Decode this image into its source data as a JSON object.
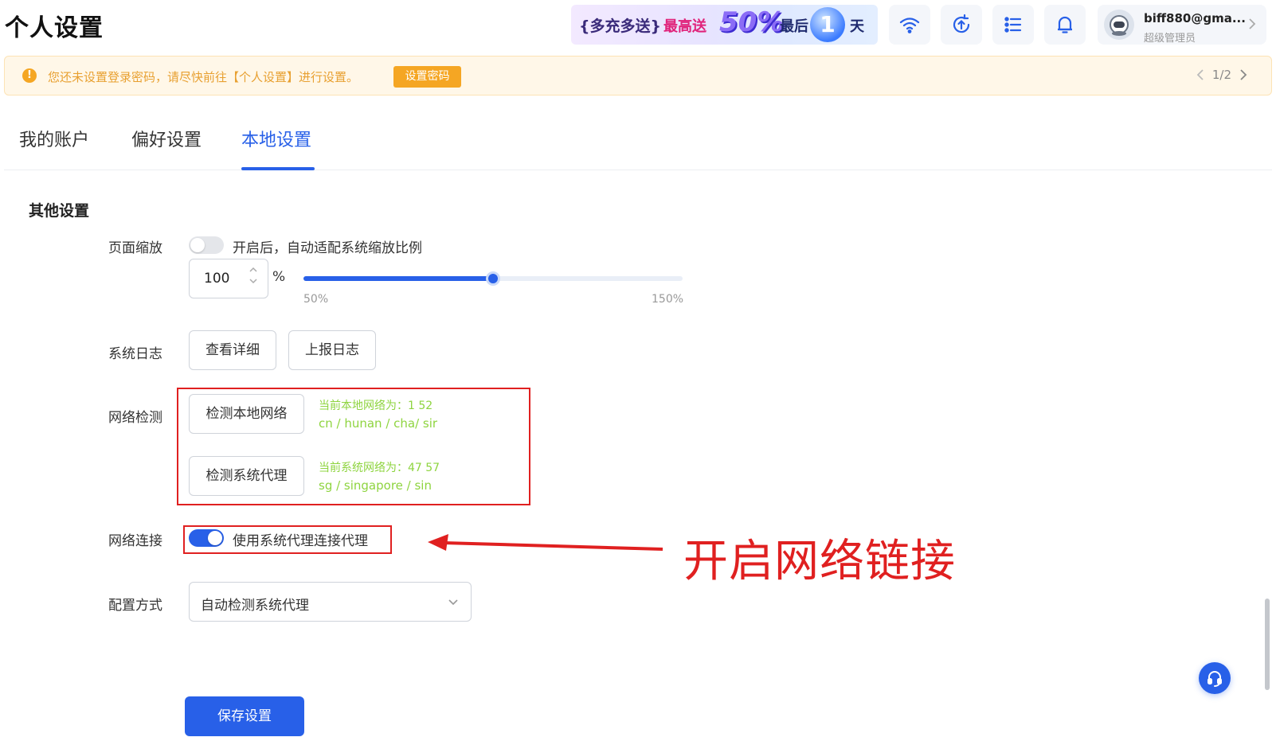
{
  "header": {
    "title": "个人设置",
    "promo": {
      "part1": "{多充多送}",
      "part2": "最高送",
      "part3": "50%",
      "part4": "最后",
      "part5": "1",
      "part6": "天"
    },
    "icons": [
      "wifi-icon",
      "sync-upload-icon",
      "list-icon",
      "bell-icon"
    ],
    "user": {
      "name": "biff880@gma...",
      "role": "超级管理员"
    }
  },
  "notice": {
    "text": "您还未设置登录密码，请尽快前往【个人设置】进行设置。",
    "button": "设置密码",
    "pager": "1/2"
  },
  "tabs": [
    {
      "label": "我的账户"
    },
    {
      "label": "偏好设置"
    },
    {
      "label": "本地设置",
      "active": true
    }
  ],
  "section": {
    "title": "其他设置",
    "zoom": {
      "label": "页面缩放",
      "switch_on": false,
      "hint": "开启后，自动适配系统缩放比例",
      "value": "100",
      "unit": "%",
      "slider_min": "50%",
      "slider_max": "150%",
      "slider_value": 100
    },
    "log": {
      "label": "系统日志",
      "view_button": "查看详细",
      "report_button": "上报日志"
    },
    "network_check": {
      "label": "网络检测",
      "local_button": "检测本地网络",
      "local_line1": "当前本地网络为：1        52",
      "local_line2": "cn / hunan / cha/ sir",
      "proxy_button": "检测系统代理",
      "proxy_line1": "当前系统网络为：47        57",
      "proxy_line2": "sg / singapore / sin"
    },
    "network_connect": {
      "label": "网络连接",
      "switch_on": true,
      "hint": "使用系统代理连接代理"
    },
    "config": {
      "label": "配置方式",
      "selected": "自动检测系统代理"
    },
    "save_button": "保存设置"
  },
  "annotation": {
    "text": "开启网络链接"
  },
  "colors": {
    "primary": "#2860e8",
    "warning": "#f5a623",
    "annotation": "#e02020",
    "success_text": "#8ed43f"
  }
}
